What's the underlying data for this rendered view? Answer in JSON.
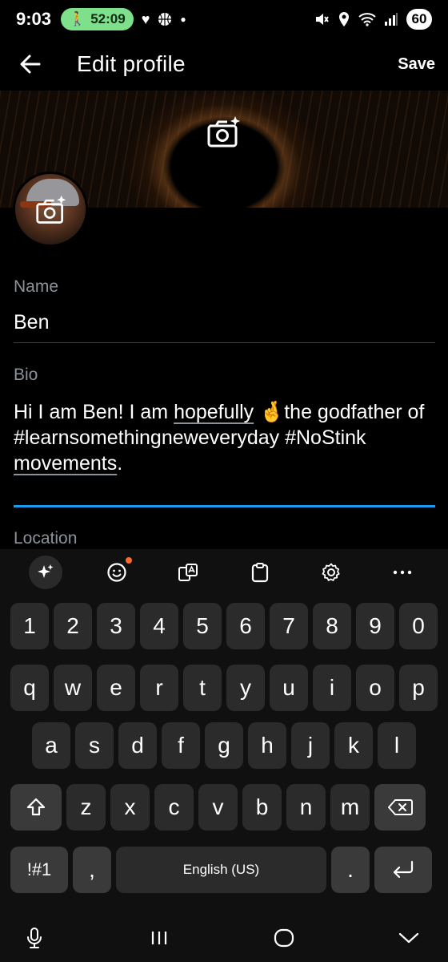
{
  "status_bar": {
    "time": "9:03",
    "walk_timer": "52:09",
    "battery": "60",
    "icons_left": [
      "walk-icon",
      "heart-icon",
      "basketball-icon",
      "dot-icon"
    ],
    "icons_right": [
      "mute-icon",
      "location-icon",
      "wifi-icon",
      "signal-icon"
    ]
  },
  "app_bar": {
    "title": "Edit profile",
    "save_label": "Save",
    "back_icon": "arrow-left-icon"
  },
  "profile": {
    "name_label": "Name",
    "name_value": "Ben",
    "bio_label": "Bio",
    "bio": {
      "part1": "Hi I am Ben! I am ",
      "underlined1": "hopefully",
      "emoji": "🤞",
      "part2": "the godfather of #learnsomethingneweveryday #NoStink ",
      "underlined2": "movements",
      "part3": "."
    },
    "location_label": "Location"
  },
  "keyboard": {
    "toolbar_icons": [
      "sparkle-icon",
      "emoji-icon",
      "translate-icon",
      "clipboard-icon",
      "settings-icon",
      "more-icon"
    ],
    "row_numbers": [
      "1",
      "2",
      "3",
      "4",
      "5",
      "6",
      "7",
      "8",
      "9",
      "0"
    ],
    "row_q": [
      "q",
      "w",
      "e",
      "r",
      "t",
      "y",
      "u",
      "i",
      "o",
      "p"
    ],
    "row_a": [
      "a",
      "s",
      "d",
      "f",
      "g",
      "h",
      "j",
      "k",
      "l"
    ],
    "row_z": [
      "z",
      "x",
      "c",
      "v",
      "b",
      "n",
      "m"
    ],
    "symbols_label": "!#1",
    "comma": ",",
    "space_label": "English (US)",
    "period": "."
  },
  "colors": {
    "accent": "#1d9bf0",
    "divider": "#3b3f44",
    "label": "#8b9298",
    "walk_pill": "#7ee08a"
  }
}
